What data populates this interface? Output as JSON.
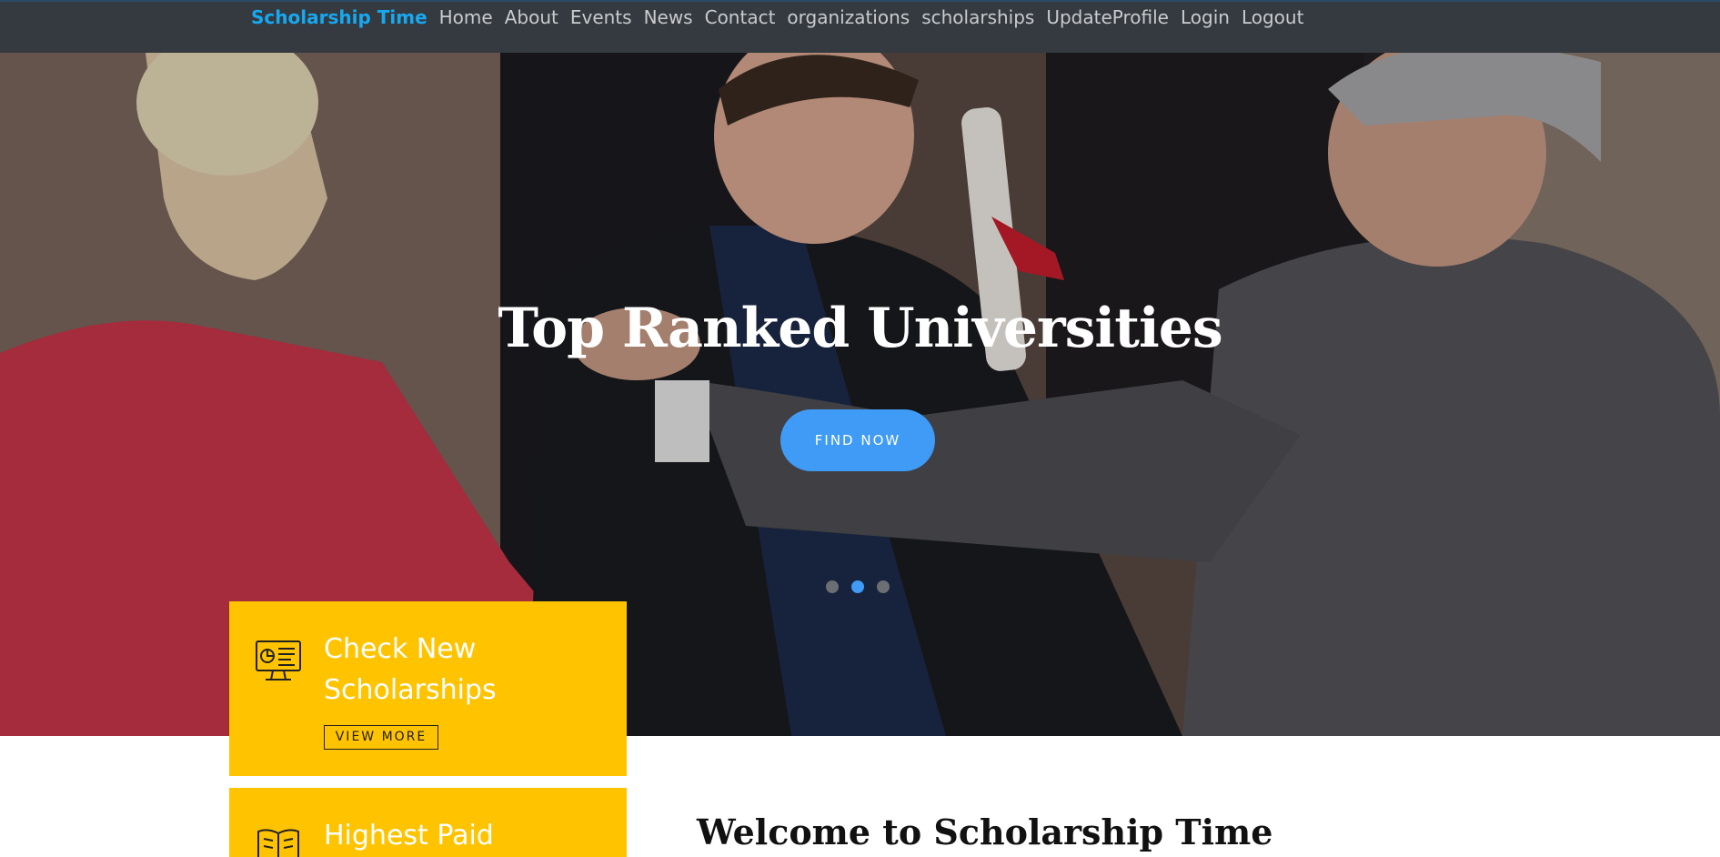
{
  "nav": {
    "brand": "Scholarship Time",
    "links": [
      "Home",
      "About",
      "Events",
      "News",
      "Contact",
      "organizations",
      "scholarships",
      "UpdateProfile",
      "Login",
      "Logout"
    ]
  },
  "hero": {
    "title": "Top Ranked Universities",
    "button": "FIND NOW",
    "slides_total": 3,
    "active_slide": 2
  },
  "cards": [
    {
      "title": "Check New Scholarships",
      "button": "VIEW MORE",
      "icon": "monitor-chart-icon"
    },
    {
      "title": "Highest Paid",
      "icon": "open-book-icon"
    }
  ],
  "welcome": {
    "heading": "Welcome to Scholarship Time"
  },
  "colors": {
    "navbar": "#343a40",
    "brand": "#17a8f0",
    "accent": "#3f9bf5",
    "card": "#ffc300"
  }
}
